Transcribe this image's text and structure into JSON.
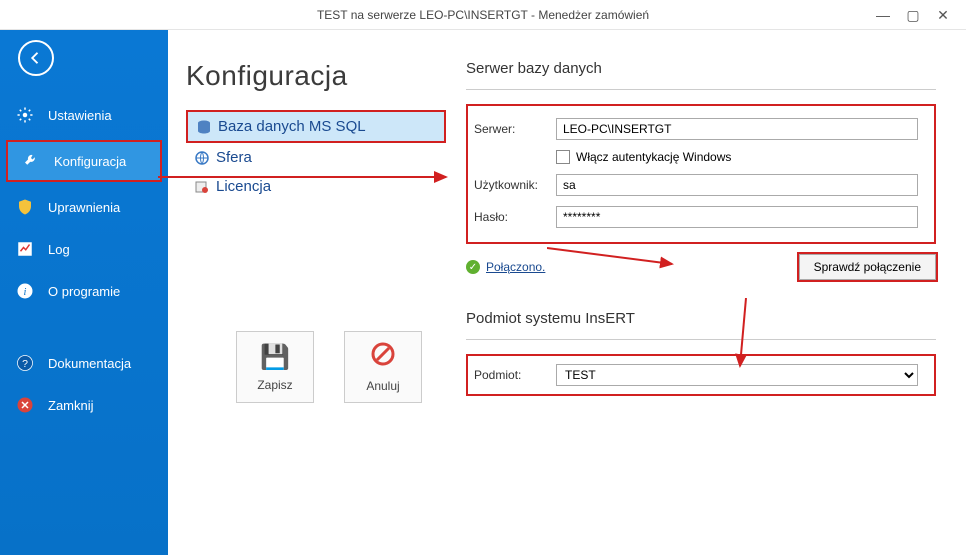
{
  "window": {
    "title": "TEST na serwerze LEO-PC\\INSERTGT - Menedżer zamówień"
  },
  "sidebar": {
    "items": [
      {
        "label": "Ustawienia"
      },
      {
        "label": "Konfiguracja"
      },
      {
        "label": "Uprawnienia"
      },
      {
        "label": "Log"
      },
      {
        "label": "O programie"
      }
    ],
    "bottom": [
      {
        "label": "Dokumentacja"
      },
      {
        "label": "Zamknij"
      }
    ]
  },
  "page": {
    "title": "Konfiguracja",
    "subnav": [
      {
        "label": "Baza danych MS SQL"
      },
      {
        "label": "Sfera"
      },
      {
        "label": "Licencja"
      }
    ]
  },
  "actions": {
    "save": "Zapisz",
    "cancel": "Anuluj"
  },
  "db": {
    "section": "Serwer bazy danych",
    "server_label": "Serwer:",
    "server_value": "LEO-PC\\INSERTGT",
    "winauth_label": "Włącz autentykację Windows",
    "user_label": "Użytkownik:",
    "user_value": "sa",
    "pass_label": "Hasło:",
    "pass_value": "********",
    "status": "Połączono.",
    "check_btn": "Sprawdź połączenie"
  },
  "entity": {
    "section": "Podmiot systemu InsERT",
    "label": "Podmiot:",
    "value": "TEST"
  }
}
